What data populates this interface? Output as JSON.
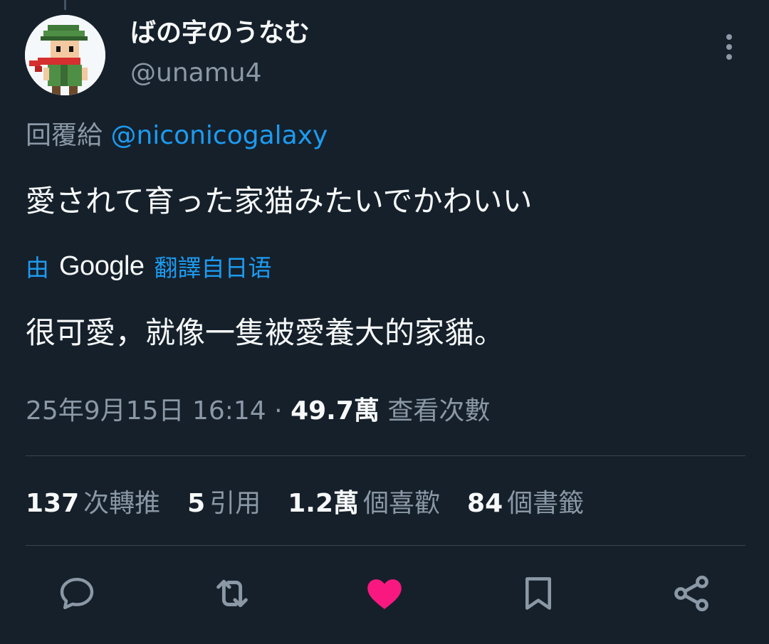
{
  "author": {
    "display_name": "ばの字のうなむ",
    "handle": "@unamu4"
  },
  "reply": {
    "prefix": "回覆給 ",
    "mention": "@niconicogalaxy"
  },
  "tweet": {
    "text": "愛されて育った家猫みたいでかわいい"
  },
  "translation": {
    "by": "由",
    "engine": "Google",
    "label": "翻譯自日语",
    "text": "很可愛，就像一隻被愛養大的家貓。"
  },
  "meta": {
    "timestamp": "25年9月15日 16:14",
    "separator": " · ",
    "views_count": "49.7萬",
    "views_label": " 查看次數"
  },
  "stats": {
    "retweets_count": "137",
    "retweets_label": "次轉推",
    "quotes_count": "5",
    "quotes_label": "引用",
    "likes_count": "1.2萬",
    "likes_label": "個喜歡",
    "bookmarks_count": "84",
    "bookmarks_label": "個書籤"
  },
  "actions": {
    "reply_icon": "reply-bubble-icon",
    "retweet_icon": "retweet-arrows-icon",
    "like_icon": "heart-icon",
    "bookmark_icon": "bookmark-icon",
    "share_icon": "share-icon",
    "liked": true
  },
  "colors": {
    "background": "#15202b",
    "text_primary": "#f7f9f9",
    "text_secondary": "#8b98a5",
    "accent": "#1d9bf0",
    "like": "#f91880",
    "divider": "#38444d"
  }
}
